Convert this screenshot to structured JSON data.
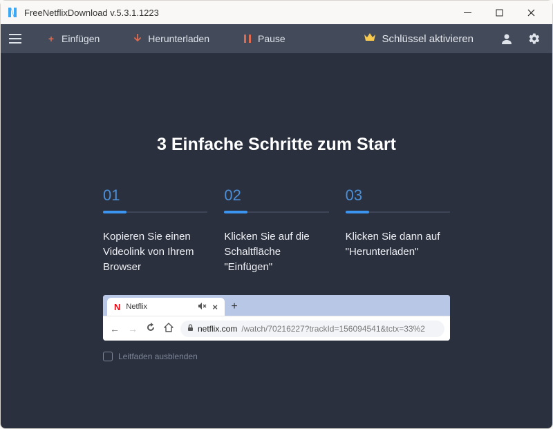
{
  "titlebar": {
    "app_name": "FreeNetflixDownload  v.5.3.1.1223"
  },
  "toolbar": {
    "paste_label": "Einfügen",
    "download_label": "Herunterladen",
    "pause_label": "Pause",
    "activate_label": "Schlüssel aktivieren"
  },
  "guide": {
    "heading": "3 Einfache Schritte zum Start",
    "steps": [
      {
        "num": "01",
        "text": "Kopieren Sie einen Videolink von Ihrem Browser"
      },
      {
        "num": "02",
        "text": "Klicken Sie auf die Schaltfläche \"Einfügen\""
      },
      {
        "num": "03",
        "text": "Klicken Sie dann auf \"Herunterladen\""
      }
    ],
    "browser": {
      "tab_title": "Netflix",
      "url_domain": "netflix.com",
      "url_rest": "/watch/70216227?trackId=156094541&tctx=33%2"
    },
    "hide_label": "Leitfaden ausblenden"
  }
}
